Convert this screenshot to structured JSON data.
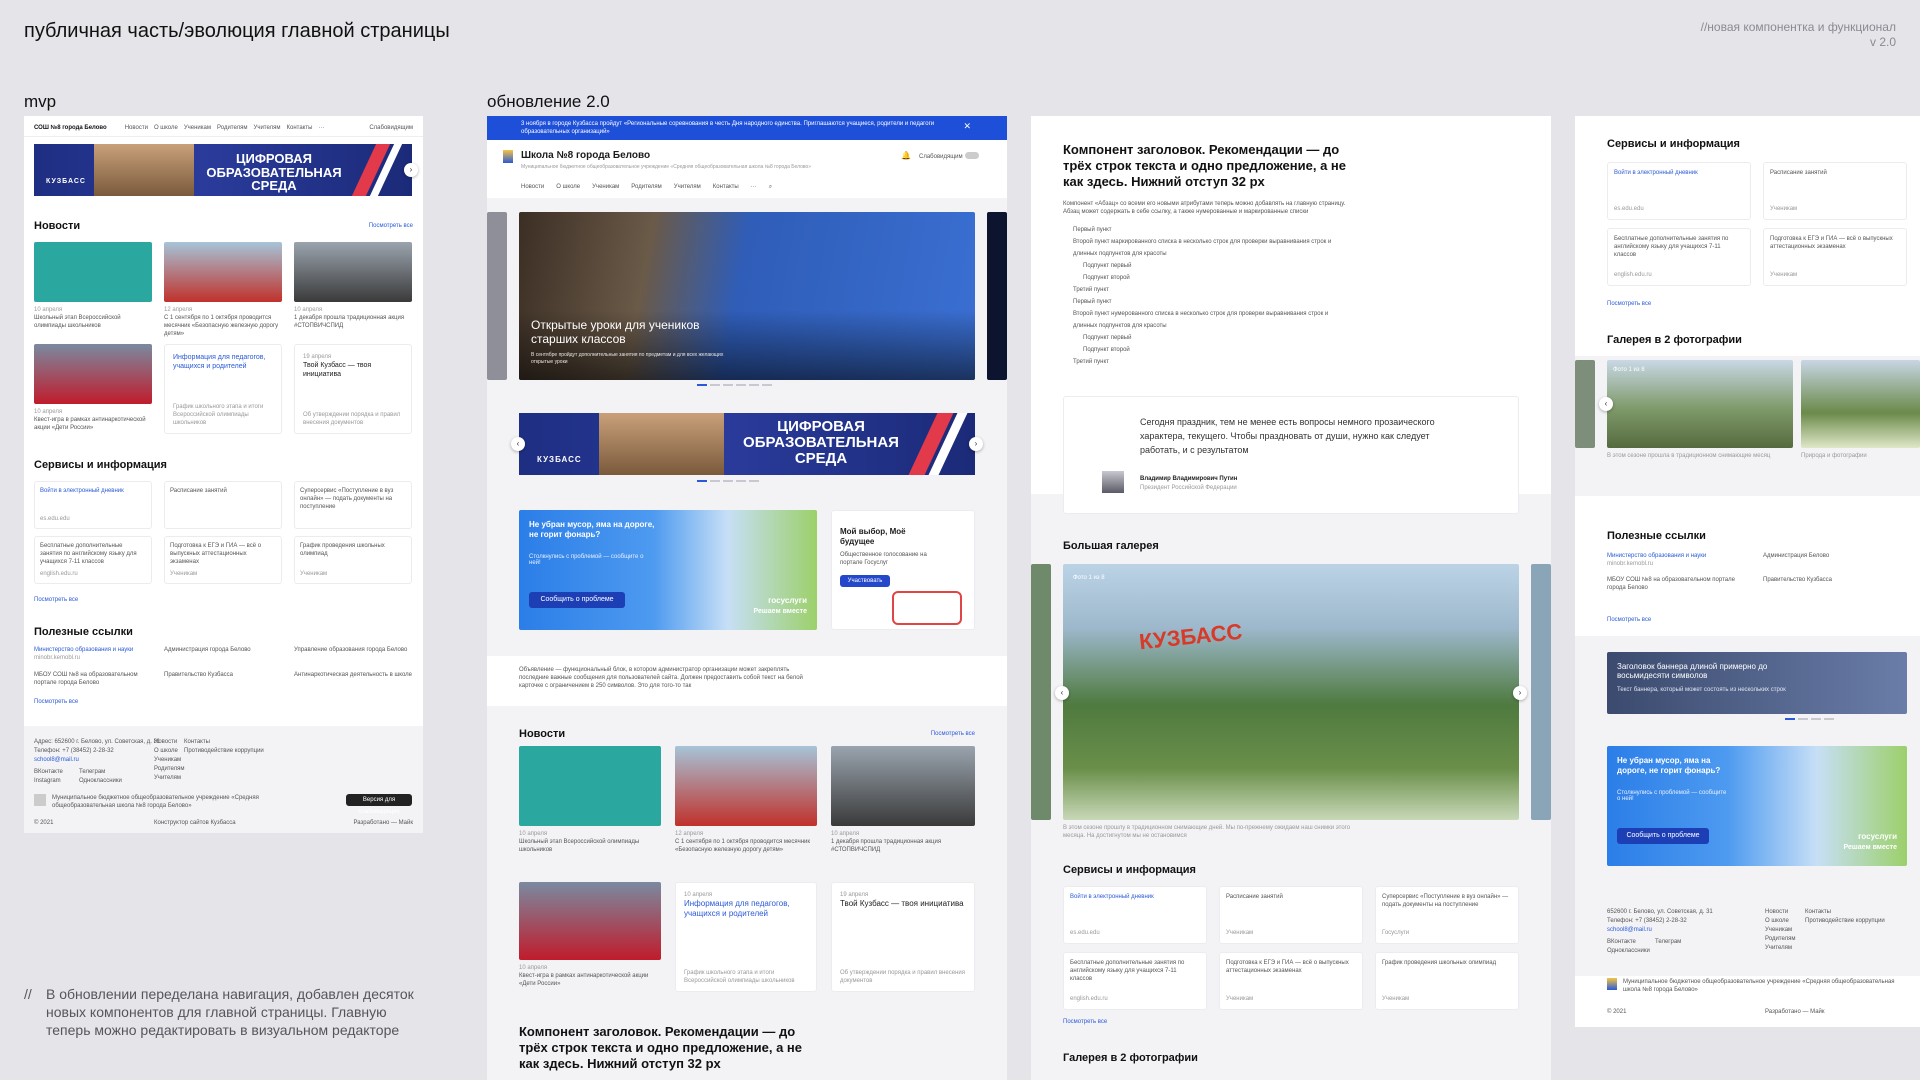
{
  "header": {
    "title": "публичная часть/эволюция главной страницы",
    "note_line1": "//новая компонентка и функционал",
    "note_line2": "v 2.0"
  },
  "columns": {
    "mvp": "mvp",
    "update": "обновление 2.0"
  },
  "footnote": {
    "prefix": "//",
    "text": "В обновлении переделана навигация, добавлен десяток новых компонентов для главной страницы. Главную теперь можно редактировать в визуальном редакторе"
  },
  "mvp": {
    "school": "СОШ №8 города Белово",
    "nav": [
      "Новости",
      "О школе",
      "Ученикам",
      "Родителям",
      "Учителям",
      "Контакты",
      "···"
    ],
    "accessibility": "Слабовидящим",
    "banner": {
      "title": "ЦИФРОВАЯ ОБРАЗОВАТЕЛЬНАЯ СРЕДА",
      "brand": "КУЗБАСС"
    },
    "news_title": "Новости",
    "news_all": "Посмотреть все",
    "news": [
      {
        "date": "10 апреля",
        "text": "Школьный этап Всероссийской олимпиады школьников"
      },
      {
        "date": "12 апреля",
        "text": "С 1 сентября по 1 октября проводится месячник «Безопасную железную дорогу детям»"
      },
      {
        "date": "10 апреля",
        "text": "1 декабря прошла традиционная акция #СТОПВИЧСПИД"
      },
      {
        "date": "10 апреля",
        "text": "Квест-игра в рамках антинаркотической акции «Дети России»"
      },
      {
        "date": "",
        "text": "Информация для педагогов, учащихся и родителей"
      },
      {
        "date": "19 апреля",
        "text": "Твой Кузбасс — твоя инициатива"
      }
    ],
    "news_sub": [
      "График школьного этапа и итоги Всероссийской олимпиады школьников",
      "Об утверждении порядка и правил внесения документов"
    ],
    "services_title": "Сервисы и информация",
    "services": [
      {
        "title": "Войти в электронный дневник",
        "sub": "es.edu.edu"
      },
      {
        "title": "Расписание занятий",
        "sub": ""
      },
      {
        "title": "Суперсервис «Поступление в вуз онлайн» — подать документы на поступление",
        "sub": ""
      },
      {
        "title": "Бесплатные дополнительные занятия по английскому языку для учащихся 7-11 классов",
        "sub": "english.edu.ru"
      },
      {
        "title": "Подготовка к ЕГЭ и ГИА — всё о выпускных аттестационных экзаменах",
        "sub": "Ученикам"
      },
      {
        "title": "График проведения школьных олимпиад",
        "sub": "Ученикам"
      }
    ],
    "services_all": "Посмотреть все",
    "links_title": "Полезные ссылки",
    "links": [
      {
        "title": "Министерство образования и науки",
        "sub": "minobr.kemobl.ru"
      },
      {
        "title": "Администрация города Белово",
        "sub": ""
      },
      {
        "title": "Управление образования города Белово",
        "sub": ""
      },
      {
        "title": "МБОУ СОШ №8 на образовательном портале города Белово",
        "sub": ""
      },
      {
        "title": "Правительство Кузбасса",
        "sub": ""
      },
      {
        "title": "Антинаркотическая деятельность в школе",
        "sub": ""
      }
    ],
    "links_all": "Посмотреть все",
    "footer": {
      "address": "Адрес: 652600 г. Белово, ул. Советская, д. 31",
      "phone": "Телефон: +7 (38452) 2-28-32",
      "email": "school8@mail.ru",
      "social": [
        "ВКонтакте",
        "Телеграм",
        "Instagram",
        "Одноклассники"
      ],
      "menu": [
        "Новости",
        "О школе",
        "Ученикам",
        "Родителям",
        "Учителям"
      ],
      "menu2": [
        "Контакты",
        "Противодействие коррупции"
      ],
      "org": "Муниципальное бюджетное общеобразовательное учреждение «Средняя общеобразовательная школа №8 города Белово»",
      "btn": "Версия для слабовидящих",
      "year": "© 2021",
      "constructor": "Конструктор сайтов Кузбасса",
      "developer": "Разработано — Майк"
    }
  },
  "update": {
    "alert": "3 ноября в городе Кузбасса пройдут «Региональные соревнования в честь Дня народного единства. Приглашаются учащиеся, родители и педагоги образовательных организаций»",
    "school": "Школа №8 города Белово",
    "school_sub": "Муниципальное бюджетное общеобразовательное учреждение «Средняя общеобразовательная школа №8 города Белово»",
    "accessibility": "Слабовидящим",
    "nav": [
      "Новости",
      "О школе",
      "Ученикам",
      "Родителям",
      "Учителям",
      "Контакты",
      "···"
    ],
    "hero": {
      "title": "Открытые уроки для учеников старших классов",
      "sub": "В сентябре пройдут дополнительные занятия по предметам и для всех желающих открытые уроки"
    },
    "banner": {
      "title": "ЦИФРОВАЯ ОБРАЗОВАТЕЛЬНАЯ СРЕДА",
      "brand": "КУЗБАСС"
    },
    "promo": {
      "title": "Не убран мусор, яма на дороге, не горит фонарь?",
      "sub": "Столкнулись с проблемой — сообщите о ней!",
      "btn": "Сообщить о проблеме",
      "brand": "госуслуги",
      "brand_sub": "Решаем вместе"
    },
    "vote": {
      "title": "Мой выбор, Моё будущее",
      "sub": "Общественное голосование на портале Госуслуг",
      "btn": "Участвовать"
    },
    "announce": "Объявление — функциональный блок, в котором администратор организации может закреплять последние важные сообщения для пользователей сайта. Должен предоставить собой текст на белой карточке с ограничением в 250 символов. Это для того-то так",
    "news_title": "Новости",
    "news_all": "Посмотреть все",
    "news": [
      {
        "date": "10 апреля",
        "text": "Школьный этап Всероссийской олимпиады школьников"
      },
      {
        "date": "12 апреля",
        "text": "С 1 сентября по 1 октября проводится месячник «Безопасную железную дорогу детям»"
      },
      {
        "date": "10 апреля",
        "text": "1 декабря прошла традиционная акция #СТОПВИЧСПИД"
      },
      {
        "date": "10 апреля",
        "text": "Квест-игра в рамках антинаркотической акции «Дети России»"
      },
      {
        "date": "10 апреля",
        "text": "Информация для педагогов, учащихся и родителей"
      },
      {
        "date": "19 апреля",
        "text": "Твой Кузбасс — твоя инициатива"
      }
    ],
    "news_sub": [
      "График школьного этапа и итоги Всероссийской олимпиады школьников",
      "Об утверждении порядка и правил внесения документов"
    ],
    "heading_demo": "Компонент заголовок. Рекомендации — до трёх строк текста и одно предложение, а не как здесь. Нижний отступ 32 px"
  },
  "components": {
    "heading": "Компонент заголовок. Рекомендации — до трёх строк текста и одно предложение, а не как здесь. Нижний отступ 32 px",
    "para": "Компонент «Абзац» со всеми его новыми атрибутами теперь можно добавлять на главную страницу. Абзац может содержать в себе ссылку, а также нумерованные и маркированные списки",
    "list": [
      "Первый пункт",
      "Второй пункт маркированного списка в несколько строк для проверки выравнивания строк и длинных подпунктов для красоты",
      "Подпункт первый",
      "Подпункт второй",
      "Третий пункт",
      "Первый пункт",
      "Второй пункт нумерованного списка в несколько строк для проверки выравнивания строк и длинных подпунктов для красоты",
      "Подпункт первый",
      "Подпункт второй",
      "Третий пункт"
    ],
    "quote": "Сегодня праздник, тем не менее есть вопросы немного прозаического характера, текущего. Чтобы праздновать от души, нужно как следует работать, и с результатом",
    "quote_author": "Владимир Владимирович Путин",
    "quote_role": "Президент Российской Федерации",
    "gallery_title": "Большая галерея",
    "gallery_counter": "Фото 1 из 8",
    "gallery_caption": "В этом сезоне прошлу в традиционном снимающие дней. Мы по-прежнему ожидаем наш снимки этого месяца. На достигнутом мы не остановимся",
    "services_title": "Сервисы и информация",
    "services": [
      {
        "title": "Войти в электронный дневник",
        "sub": "es.edu.edu"
      },
      {
        "title": "Расписание занятий",
        "sub": "Ученикам"
      },
      {
        "title": "Суперсервис «Поступление в вуз онлайн» — подать документы на поступление",
        "sub": "Госуслуги"
      },
      {
        "title": "Бесплатные дополнительные занятия по английскому языку для учащихся 7-11 классов",
        "sub": "english.edu.ru"
      },
      {
        "title": "Подготовка к ЕГЭ и ГИА — всё о выпускных аттестационных экзаменах",
        "sub": "Ученикам"
      },
      {
        "title": "График проведения школьных олимпиад",
        "sub": "Ученикам"
      }
    ],
    "services_all": "Посмотреть все",
    "gallery2_title": "Галерея в 2 фотографии"
  },
  "right": {
    "services_title": "Сервисы и информация",
    "services": [
      {
        "title": "Войти в электронный дневник",
        "sub": "es.edu.edu"
      },
      {
        "title": "Расписание занятий",
        "sub": "Ученикам"
      },
      {
        "title": "Бесплатные дополнительные занятия по английскому языку для учащихся 7-11 классов",
        "sub": "english.edu.ru"
      },
      {
        "title": "Подготовка к ЕГЭ и ГИА — всё о выпускных аттестационных экзаменах",
        "sub": "Ученикам"
      }
    ],
    "services_all": "Посмотреть все",
    "gallery_title": "Галерея в 2 фотографии",
    "gallery_counter": "Фото 1 из 8",
    "gallery_caption": "В этом сезоне прошла в традиционном снимающие месяц",
    "gallery_caption2": "Природа и фотографии",
    "links_title": "Полезные ссылки",
    "links": [
      {
        "title": "Министерство образования и науки",
        "sub": "minobr.kemobl.ru"
      },
      {
        "title": "Администрация Белово",
        "sub": ""
      },
      {
        "title": "МБОУ СОШ №8 на образовательном портале города Белово",
        "sub": ""
      },
      {
        "title": "Правительство Кузбасса",
        "sub": ""
      }
    ],
    "links_all": "Посмотреть все",
    "banner_title": "Заголовок баннера длиной примерно до восьмидесяти символов",
    "banner_sub": "Текст баннера, который может состоять из нескольких строк",
    "promo": {
      "title": "Не убран мусор, яма на дороге, не горит фонарь?",
      "sub": "Столкнулись с проблемой — сообщите о ней!",
      "btn": "Сообщить о проблеме",
      "brand": "госуслуги",
      "brand_sub": "Решаем вместе"
    },
    "footer": {
      "address": "652600 г. Белово, ул. Советская, д. 31",
      "phone": "Телефон: +7 (38452) 2-28-32",
      "email": "school8@mail.ru",
      "social": [
        "ВКонтакте",
        "Телеграм",
        "Одноклассники"
      ],
      "menu": [
        "Новости",
        "О школе",
        "Ученикам",
        "Родителям",
        "Учителям"
      ],
      "menu2": [
        "Контакты",
        "Противодействие коррупции"
      ],
      "org": "Муниципальное бюджетное общеобразовательное учреждение «Средняя общеобразовательная школа №8 города Белово»",
      "year": "© 2021",
      "developer": "Разработано — Майк"
    }
  },
  "colors": {
    "accent": "#2a5ad7",
    "banner": "#1e2e82",
    "stripe": "#e23a4a",
    "alert": "#1d4fd8",
    "canvas": "#e4e4e9"
  }
}
